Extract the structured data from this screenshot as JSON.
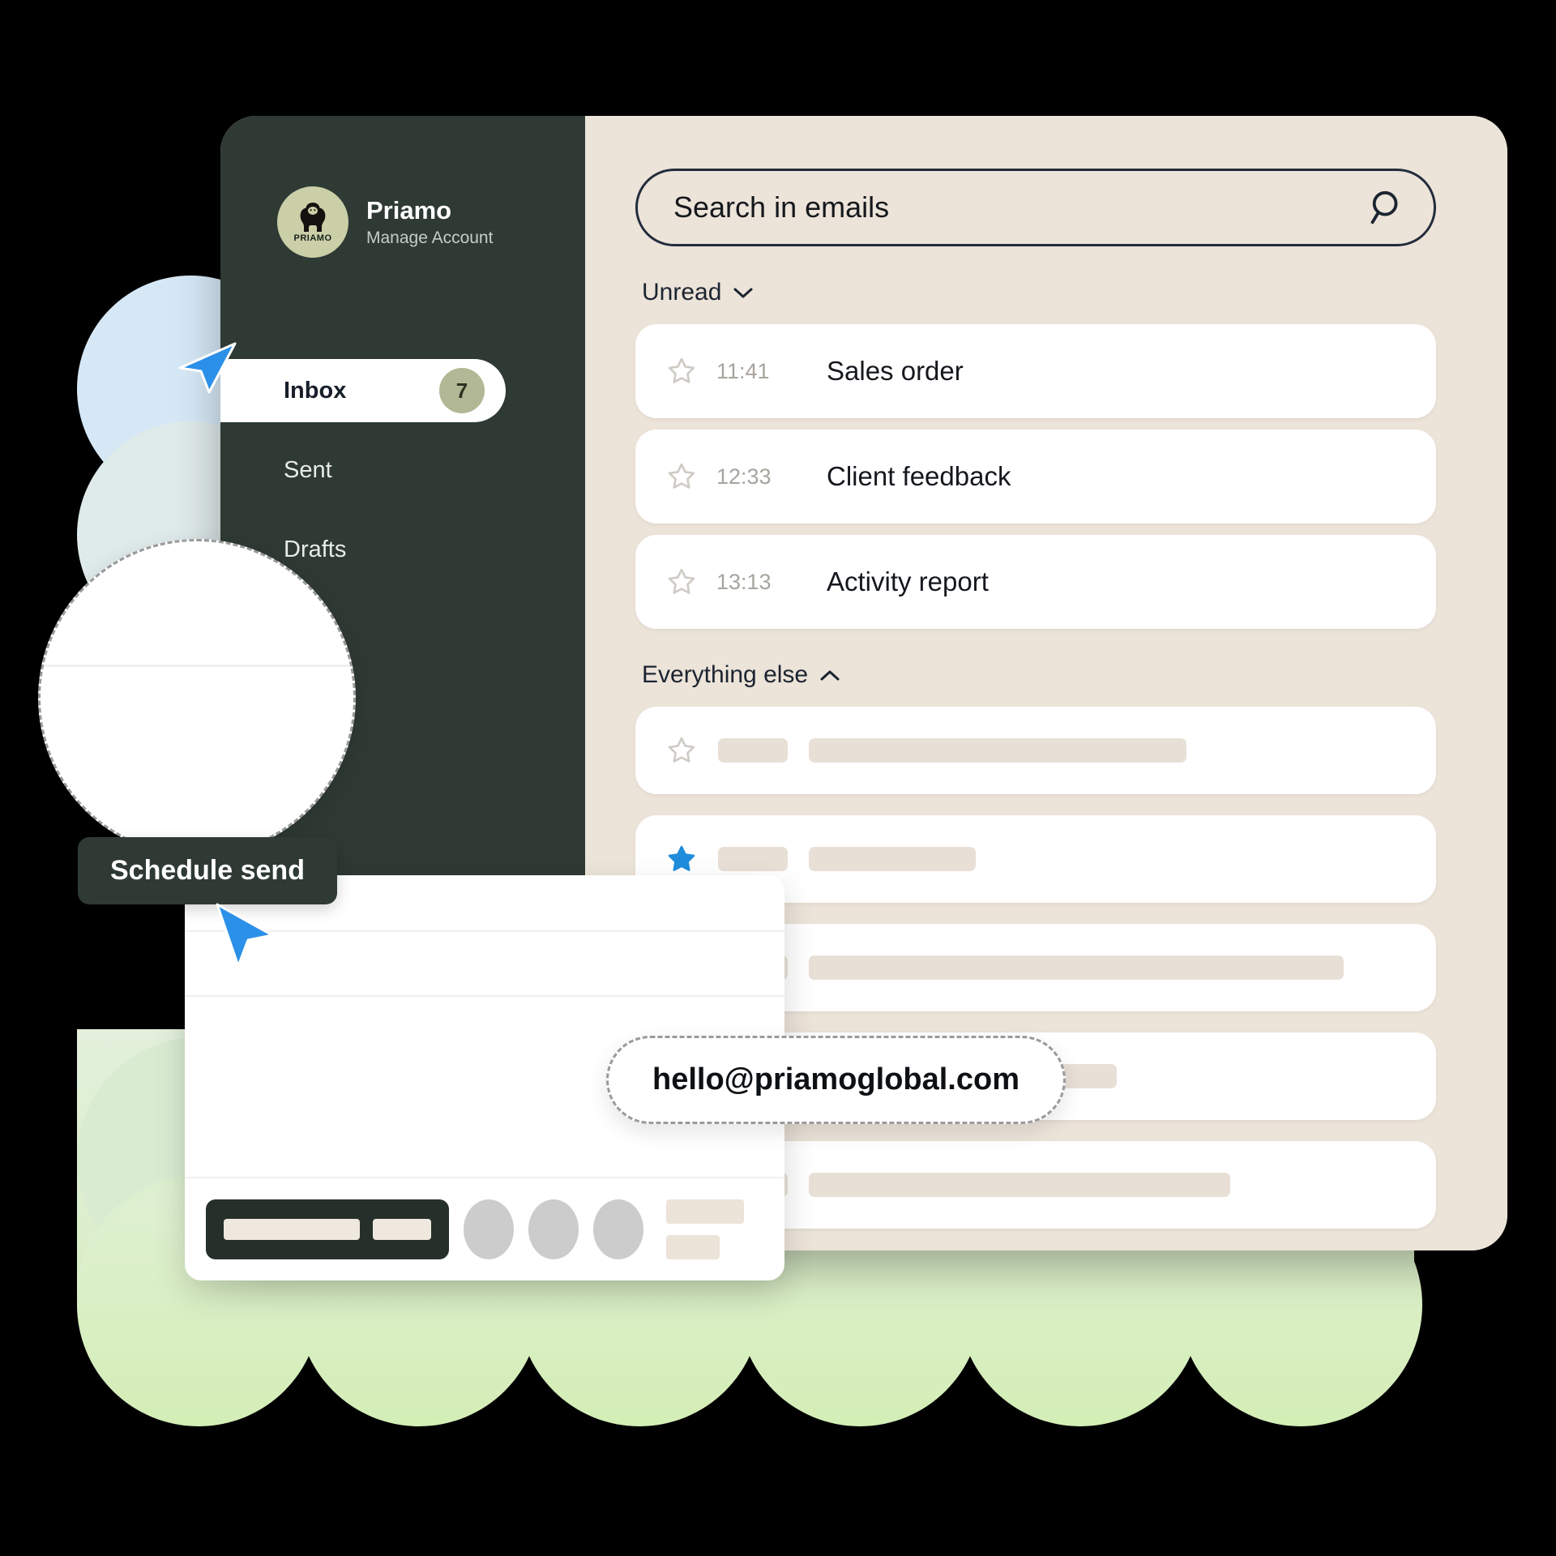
{
  "account": {
    "name": "Priamo",
    "subtitle": "Manage Account",
    "logo_word": "PRIAMO",
    "avatar_icon": "gorilla-logo-icon"
  },
  "sidebar": {
    "items": [
      {
        "label": "Inbox",
        "badge": "7",
        "active": true
      },
      {
        "label": "Sent",
        "badge": "",
        "active": false
      },
      {
        "label": "Drafts",
        "badge": "",
        "active": false
      }
    ]
  },
  "search": {
    "placeholder": "Search in emails",
    "value": "",
    "icon": "search-icon"
  },
  "sections": [
    {
      "label": "Unread",
      "chevron": "chevron-down-icon"
    },
    {
      "label": "Everything else",
      "chevron": "chevron-up-icon"
    }
  ],
  "unread_emails": [
    {
      "time": "11:41",
      "subject": "Sales order",
      "starred": false
    },
    {
      "time": "12:33",
      "subject": "Client feedback",
      "starred": false
    },
    {
      "time": "13:13",
      "subject": "Activity report",
      "starred": false
    }
  ],
  "everything_else": [
    {
      "starred": false,
      "line_width": 466
    },
    {
      "starred": true,
      "line_width": 206
    },
    {
      "starred": false,
      "line_width": 660
    },
    {
      "starred": false,
      "line_width": 380
    },
    {
      "starred": false,
      "line_width": 520
    }
  ],
  "tooltip": {
    "label": "Schedule send"
  },
  "email_pill": {
    "address": "hello@priamoglobal.com"
  },
  "composer": {
    "send_button_label": "",
    "avatar_count": 3
  },
  "colors": {
    "sidebar_bg": "#2e3a33",
    "panel_bg": "#ece3d9",
    "accent_blue": "#2b90e8",
    "badge_bg": "#b2b795",
    "avatar_bg": "#cbcfa8",
    "star_active": "#1f8cdb"
  }
}
